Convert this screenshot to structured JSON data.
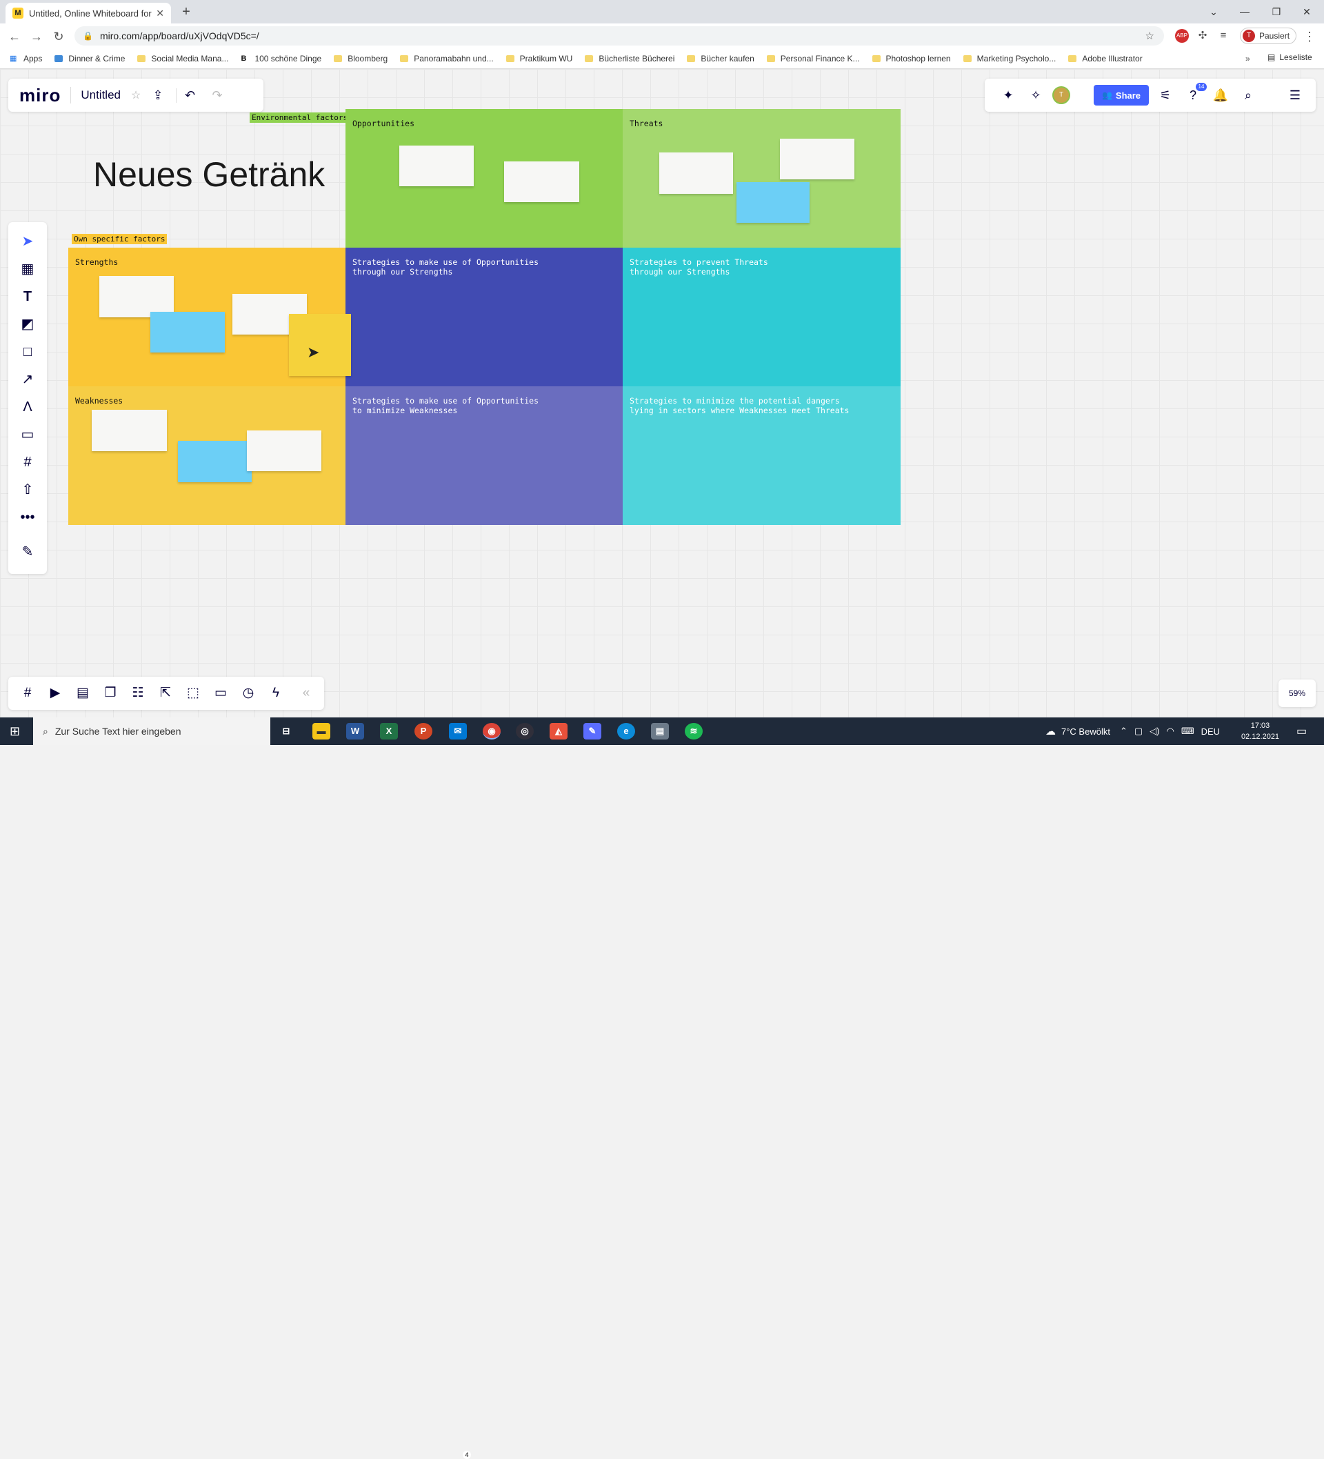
{
  "browser": {
    "tab_title": "Untitled, Online Whiteboard for",
    "tab_favicon": "M",
    "url": "miro.com/app/board/uXjVOdqVD5c=/",
    "profile_initial": "T",
    "profile_label": "Pausiert",
    "ext_abp": "ABP",
    "bookmarks": [
      "Apps",
      "Dinner & Crime",
      "Social Media Mana...",
      "100 schöne Dinge",
      "Bloomberg",
      "Panoramabahn und...",
      "Praktikum WU",
      "Bücherliste Bücherei",
      "Bücher kaufen",
      "Personal Finance K...",
      "Photoshop lernen",
      "Marketing Psycholo...",
      "Adobe Illustrator"
    ],
    "bookmarks_more": "»",
    "reading_list": "Leseliste"
  },
  "miro": {
    "logo": "miro",
    "board_name": "Untitled",
    "share_label": "Share",
    "avatar_initial": "T",
    "help_badge": "14",
    "zoom": "59%",
    "accent": "#4262ff"
  },
  "board": {
    "title": "Neues Getränk",
    "tag_environmental": "Environmental factors",
    "tag_own": "Own specific factors",
    "cells": {
      "opportunities": "Opportunities",
      "threats": "Threats",
      "strengths": "Strengths",
      "so": "Strategies to make use of Opportunities\nthrough our Strengths",
      "st": "Strategies to prevent Threats\nthrough our Strengths",
      "weaknesses": "Weaknesses",
      "wo": "Strategies to make use of Opportunities\nto minimize Weaknesses",
      "wt": "Strategies to minimize the potential dangers\nlying in sectors where Weaknesses meet Threats"
    },
    "colors": {
      "green": "#8fd14f",
      "green_light": "#a4d86e",
      "orange": "#fac635",
      "orange_light": "#f6cd45",
      "indigo": "#414bb2",
      "indigo_light": "#6a6dbf",
      "teal": "#2ecbd4",
      "teal_light": "#4fd4db"
    }
  },
  "taskbar": {
    "search_placeholder": "Zur Suche Text hier eingeben",
    "weather": "7°C  Bewölkt",
    "lang": "DEU",
    "time": "17:03",
    "date": "02.12.2021",
    "mail_badge": "4"
  }
}
